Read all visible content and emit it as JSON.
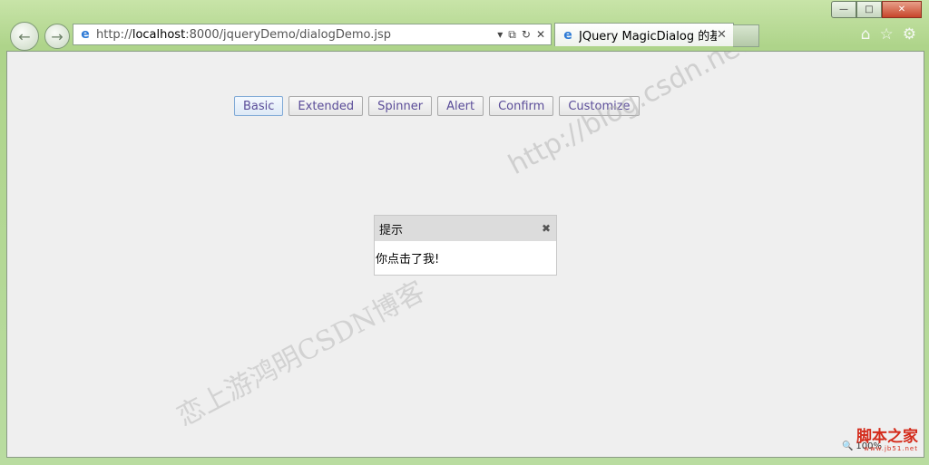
{
  "browser": {
    "url_prefix": "http://",
    "url_host": "localhost",
    "url_rest": ":8000/jqueryDemo/dialogDemo.jsp",
    "tab_title": "JQuery MagicDialog 的基...",
    "window_controls": {
      "minimize": "—",
      "maximize": "□",
      "close": "✕"
    },
    "icons": [
      "back-arrow-icon",
      "forward-arrow-icon",
      "ie-logo-icon",
      "compat-view-icon",
      "refresh-icon",
      "stop-icon",
      "home-icon",
      "favorites-star-icon",
      "tools-gear-icon"
    ]
  },
  "buttons": [
    {
      "label": "Basic"
    },
    {
      "label": "Extended"
    },
    {
      "label": "Spinner"
    },
    {
      "label": "Alert"
    },
    {
      "label": "Confirm"
    },
    {
      "label": "Customize"
    }
  ],
  "dialog": {
    "title": "提示",
    "close": "✖",
    "message": "你点击了我!"
  },
  "watermarks": {
    "url": "http://blog.csdn.net/youqishini",
    "author": "恋上游鸿明CSDN博客"
  },
  "statusbar": {
    "zoom": "100%",
    "logo_cn": "脚本之家",
    "logo_en": "www.jb51.net"
  }
}
